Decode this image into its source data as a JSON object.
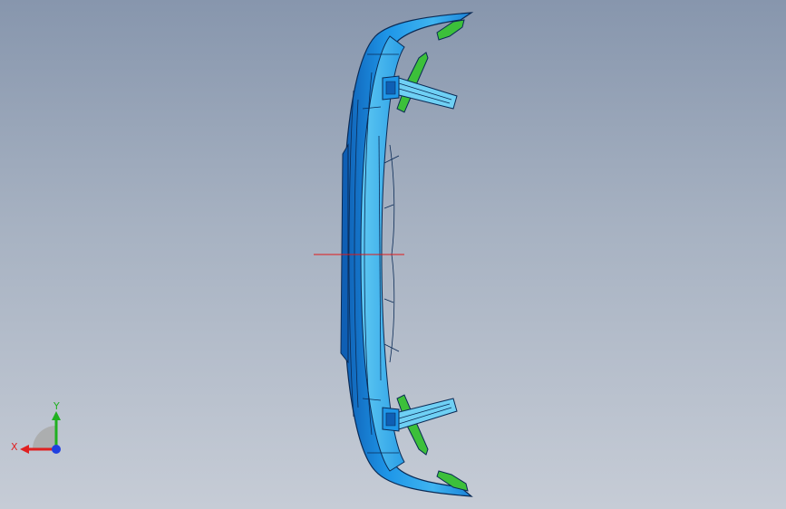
{
  "viewport": {
    "background_top": "#8796ad",
    "background_bottom": "#c6ccd6"
  },
  "model": {
    "part_color": "#1e96e8",
    "part_dark": "#0f5fb4",
    "part_light": "#5ec8f2",
    "edge_color": "#0a2a55",
    "clip_color": "#3cc03a",
    "sketch_line_color": "#e01818"
  },
  "triad": {
    "x_label": "X",
    "y_label": "Y",
    "x_color": "#e02020",
    "y_color": "#20b020",
    "z_color": "#2040e0",
    "icon": "coordinate-triad-icon"
  }
}
